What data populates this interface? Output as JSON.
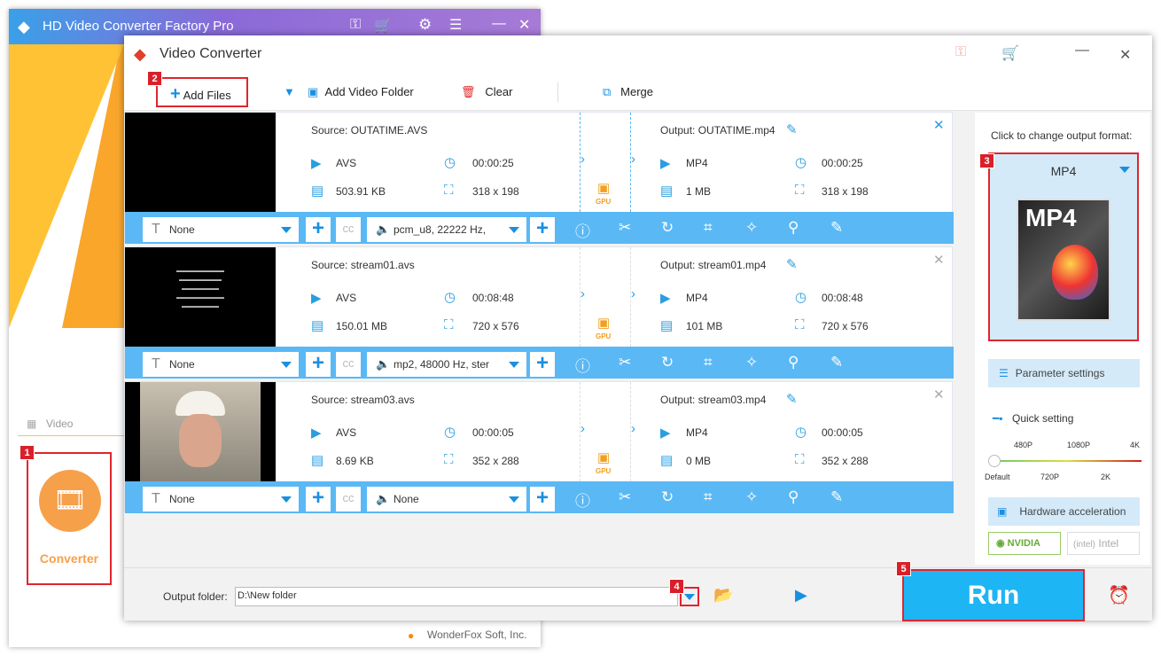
{
  "bg_window": {
    "title": "HD Video Converter Factory Pro",
    "video_tab": "Video",
    "converter_label": "Converter",
    "footer": "WonderFox Soft, Inc."
  },
  "window": {
    "title": "Video Converter"
  },
  "toolbar": {
    "add_files": "Add Files",
    "add_folder": "Add Video Folder",
    "clear": "Clear",
    "merge": "Merge"
  },
  "files": [
    {
      "source": "Source: OUTATIME.AVS",
      "src_format": "AVS",
      "src_duration": "00:00:25",
      "src_size": "503.91 KB",
      "src_res": "318 x 198",
      "output": "Output: OUTATIME.mp4",
      "out_format": "MP4",
      "out_duration": "00:00:25",
      "out_size": "1 MB",
      "out_res": "318 x 198",
      "subtitle": "None",
      "audio": "pcm_u8, 22222 Hz,",
      "gpu": "GPU",
      "thumb": "black"
    },
    {
      "source": "Source: stream01.avs",
      "src_format": "AVS",
      "src_duration": "00:08:48",
      "src_size": "150.01 MB",
      "src_res": "720 x 576",
      "output": "Output: stream01.mp4",
      "out_format": "MP4",
      "out_duration": "00:08:48",
      "out_size": "101 MB",
      "out_res": "720 x 576",
      "subtitle": "None",
      "audio": "mp2, 48000 Hz, ster",
      "gpu": "GPU",
      "thumb": "credits"
    },
    {
      "source": "Source: stream03.avs",
      "src_format": "AVS",
      "src_duration": "00:00:05",
      "src_size": "8.69 KB",
      "src_res": "352 x 288",
      "output": "Output: stream03.mp4",
      "out_format": "MP4",
      "out_duration": "00:00:05",
      "out_size": "0 MB",
      "out_res": "352 x 288",
      "subtitle": "None",
      "audio": "None",
      "gpu": "GPU",
      "thumb": "person"
    }
  ],
  "right_panel": {
    "hint": "Click to change output format:",
    "format": "MP4",
    "format_icon_text": "MP4",
    "param_settings": "Parameter settings",
    "quick_setting": "Quick setting",
    "quality_top": [
      "480P",
      "1080P",
      "4K"
    ],
    "quality_bottom": [
      "Default",
      "720P",
      "2K"
    ],
    "quality_value": "Default",
    "hw_accel": "Hardware acceleration",
    "nvidia": "NVIDIA",
    "intel": "Intel"
  },
  "bottom": {
    "output_label": "Output folder:",
    "output_path": "D:\\New folder",
    "run": "Run"
  },
  "badges": [
    "1",
    "2",
    "3",
    "4",
    "5"
  ],
  "colors": {
    "accent": "#1a8fe0",
    "run": "#1eb5f5",
    "badge": "#d9202a"
  }
}
